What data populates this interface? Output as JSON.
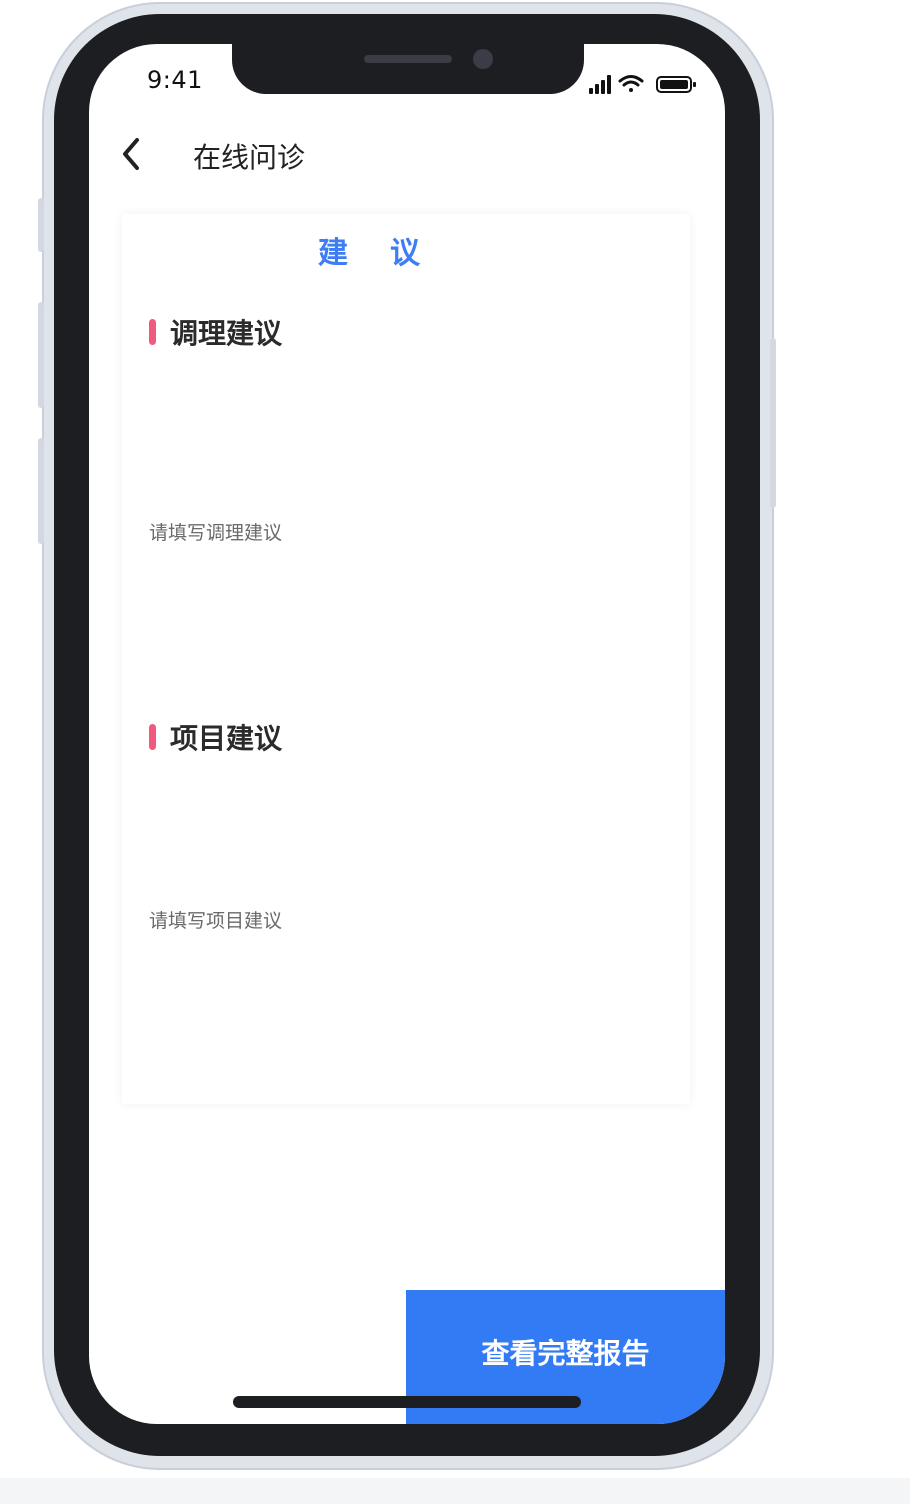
{
  "status_bar": {
    "time": "9:41"
  },
  "nav": {
    "title": "在线问诊",
    "back_icon": "chevron-left-icon"
  },
  "card": {
    "heading": "建议",
    "sections": [
      {
        "title": "调理建议",
        "placeholder": "请填写调理建议"
      },
      {
        "title": "项目建议",
        "placeholder": "请填写项目建议"
      }
    ]
  },
  "footer": {
    "button_label": "查看完整报告"
  },
  "colors": {
    "accent": "#3e7ef5",
    "button": "#337bf5",
    "section_marker": "#f05a7e",
    "frame": "#1d1e22"
  }
}
